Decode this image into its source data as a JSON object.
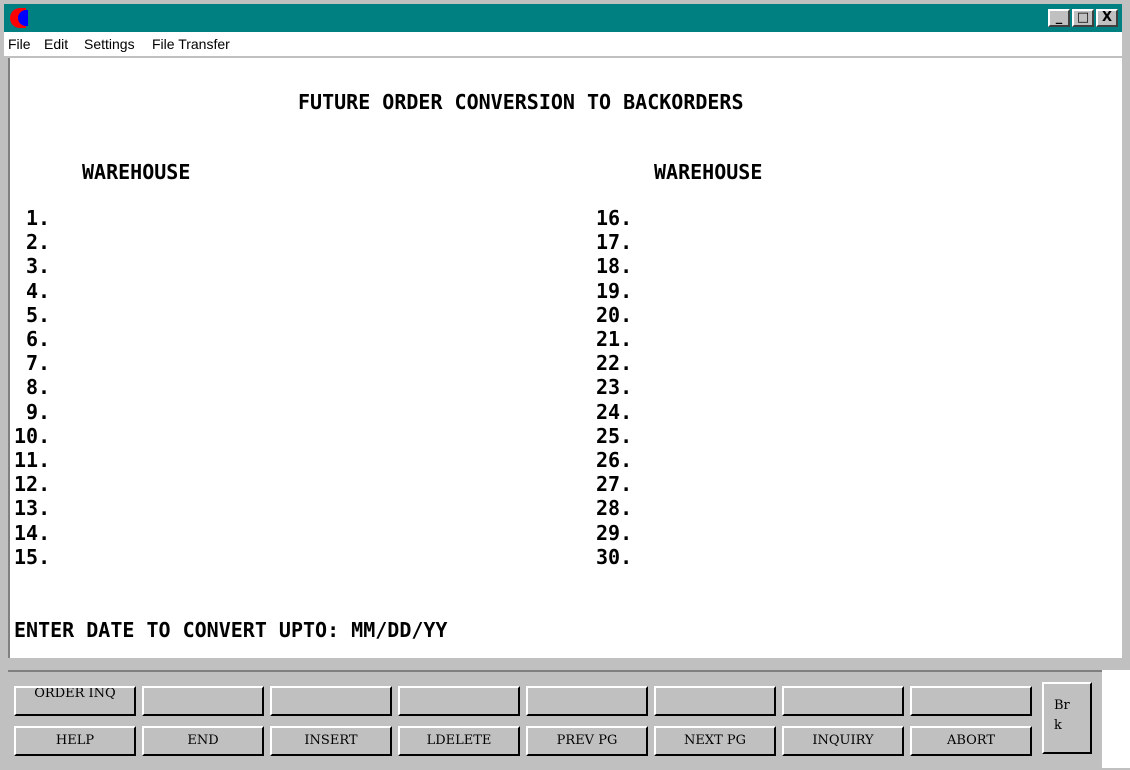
{
  "titlebar": {
    "icon": "app-crescent-icon",
    "buttons": [
      "_",
      "□",
      "X"
    ]
  },
  "menu": {
    "items": [
      "File",
      "Edit",
      "Settings",
      "File Transfer"
    ]
  },
  "screen": {
    "title": "FUTURE ORDER CONVERSION TO BACKORDERS",
    "left_header": "WAREHOUSE",
    "right_header": "WAREHOUSE",
    "left_items": [
      "1.",
      "2.",
      "3.",
      "4.",
      "5.",
      "6.",
      "7.",
      "8.",
      "9.",
      "10.",
      "11.",
      "12.",
      "13.",
      "14.",
      "15."
    ],
    "right_items": [
      "16.",
      "17.",
      "18.",
      "19.",
      "20.",
      "21.",
      "22.",
      "23.",
      "24.",
      "25.",
      "26.",
      "27.",
      "28.",
      "29.",
      "30."
    ],
    "prompt": "ENTER DATE TO CONVERT UPTO: MM/DD/YY"
  },
  "fkeys": {
    "top": [
      "ORDER INQ",
      "",
      "",
      "",
      "",
      "",
      "",
      ""
    ],
    "bottom": [
      "HELP",
      "END",
      "INSERT",
      "LDELETE",
      "PREV PG",
      "NEXT PG",
      "INQUIRY",
      "ABORT"
    ],
    "brk": "Br\nk"
  }
}
